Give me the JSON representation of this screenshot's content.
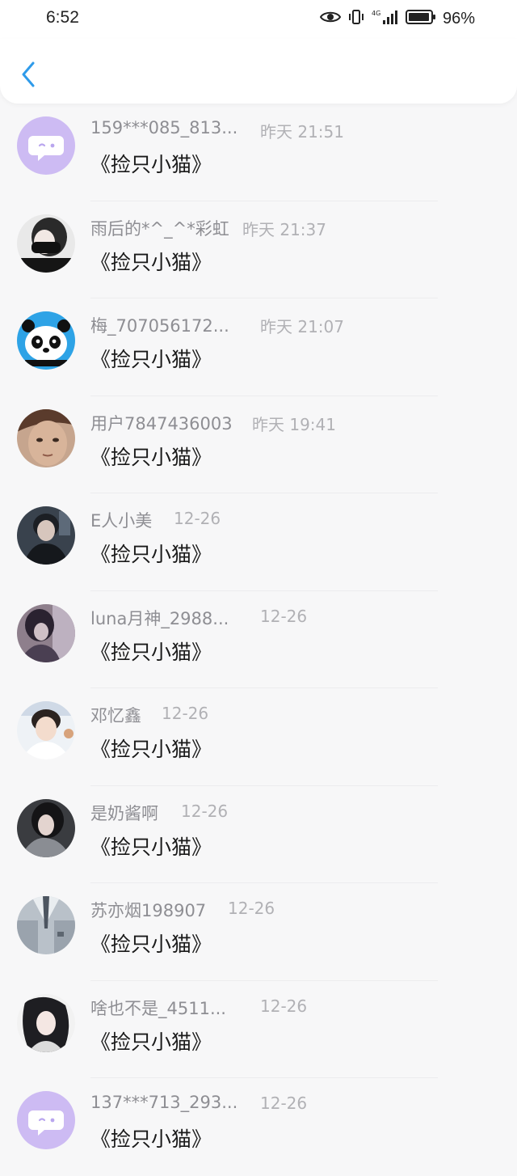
{
  "status_bar": {
    "time": "6:52",
    "battery": "96%",
    "network": "4G"
  },
  "header": {
    "back_icon": "chevron-left-icon",
    "accent": "#2f9bea"
  },
  "items": [
    {
      "username": "159***085_813...",
      "time": "昨天 21:51",
      "message": "《捡只小猫》",
      "avatar": "default-chat-avatar"
    },
    {
      "username": "雨后的*^_^*彩虹",
      "time": "昨天 21:37",
      "message": "《捡只小猫》",
      "avatar": "photo-avatar"
    },
    {
      "username": "梅_707056172...",
      "time": "昨天 21:07",
      "message": "《捡只小猫》",
      "avatar": "panda-avatar"
    },
    {
      "username": "用户7847436003",
      "time": "昨天 19:41",
      "message": "《捡只小猫》",
      "avatar": "photo-avatar"
    },
    {
      "username": "E人小美",
      "time": "12-26",
      "message": "《捡只小猫》",
      "avatar": "photo-avatar"
    },
    {
      "username": "luna月神_2988...",
      "time": "12-26",
      "message": "《捡只小猫》",
      "avatar": "photo-avatar"
    },
    {
      "username": "邓忆鑫",
      "time": "12-26",
      "message": "《捡只小猫》",
      "avatar": "photo-avatar"
    },
    {
      "username": "是奶酱啊",
      "time": "12-26",
      "message": "《捡只小猫》",
      "avatar": "photo-avatar"
    },
    {
      "username": "苏亦烟198907",
      "time": "12-26",
      "message": "《捡只小猫》",
      "avatar": "photo-avatar"
    },
    {
      "username": "啥也不是_4511...",
      "time": "12-26",
      "message": "《捡只小猫》",
      "avatar": "photo-avatar"
    },
    {
      "username": "137***713_293...",
      "time": "12-26",
      "message": "《捡只小猫》",
      "avatar": "default-chat-avatar"
    }
  ]
}
